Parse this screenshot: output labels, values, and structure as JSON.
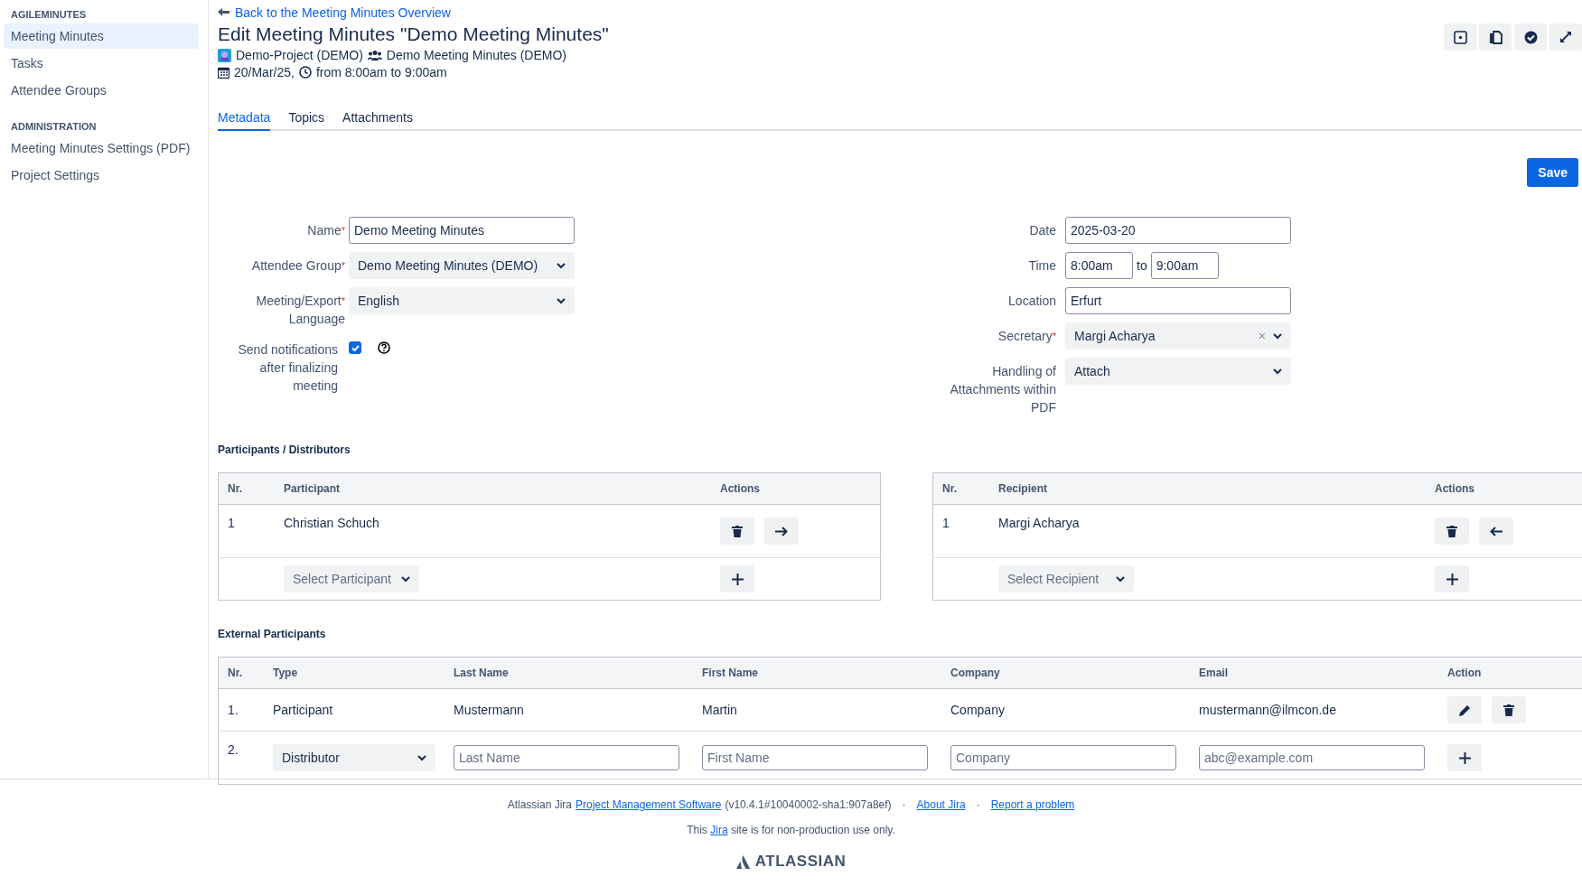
{
  "sidebar": {
    "sections": [
      {
        "heading": "AGILEMINUTES",
        "items": [
          {
            "label": "Meeting Minutes",
            "selected": true
          },
          {
            "label": "Tasks",
            "selected": false
          },
          {
            "label": "Attendee Groups",
            "selected": false
          }
        ]
      },
      {
        "heading": "ADMINISTRATION",
        "items": [
          {
            "label": "Meeting Minutes Settings (PDF)",
            "selected": false
          },
          {
            "label": "Project Settings",
            "selected": false
          }
        ]
      }
    ]
  },
  "header": {
    "back_link": "Back to the Meeting Minutes Overview",
    "title": "Edit Meeting Minutes \"Demo Meeting Minutes\"",
    "project": "Demo-Project (DEMO)",
    "group": "Demo Meeting Minutes (DEMO)",
    "date": "20/Mar/25,",
    "time": "from 8:00am to 9:00am"
  },
  "tabs": [
    {
      "label": "Metadata",
      "selected": true
    },
    {
      "label": "Topics",
      "selected": false
    },
    {
      "label": "Attachments",
      "selected": false
    }
  ],
  "save_button": "Save",
  "form_left": [
    {
      "kind": "text",
      "label": "Name",
      "marker": "*",
      "value": "Demo Meeting Minutes"
    },
    {
      "kind": "select",
      "label": "Attendee Group",
      "marker": "*",
      "value": "Demo Meeting Minutes (DEMO)"
    },
    {
      "kind": "select",
      "label": "Meeting/Export",
      "marker": "*",
      "label_cont": "Language",
      "value": "English"
    },
    {
      "kind": "checkbox",
      "label": "Send notifications after finalizing meeting",
      "checked": true
    }
  ],
  "form_right": [
    {
      "kind": "text",
      "label": "Date",
      "value": "2025-03-20"
    },
    {
      "kind": "time",
      "label": "Time",
      "from": "8:00am",
      "separator": "to",
      "to": "9:00am"
    },
    {
      "kind": "text",
      "label": "Location",
      "value": "Erfurt"
    },
    {
      "kind": "select",
      "label": "Secretary",
      "marker": "*",
      "value": "Margi Acharya",
      "clear": "×"
    },
    {
      "kind": "select",
      "label": "Handling of Attachments within PDF",
      "value": "Attach"
    }
  ],
  "participants_heading": "Participants / Distributors",
  "participants": {
    "columns": [
      "Nr.",
      "Participant",
      "Actions"
    ],
    "rows": [
      {
        "nr": "1",
        "name": "Christian Schuch"
      }
    ],
    "add_placeholder": "Select Participant",
    "kind": "participants"
  },
  "recipients": {
    "columns": [
      "Nr.",
      "Recipient",
      "Actions"
    ],
    "rows": [
      {
        "nr": "1",
        "name": "Margi Acharya"
      }
    ],
    "add_placeholder": "Select Recipient",
    "kind": "recipients"
  },
  "external_heading": "External Participants",
  "external": {
    "columns": [
      "Nr.",
      "Type",
      "Last Name",
      "First Name",
      "Company",
      "Email",
      "Action"
    ],
    "rows": [
      {
        "nr": "1.",
        "type": "Participant",
        "last_name": "Mustermann",
        "first_name": "Martin",
        "company": "Company",
        "email": "mustermann@ilmcon.de"
      }
    ],
    "new_row": {
      "nr": "2.",
      "type": "Distributor",
      "last_name_placeholder": "Last Name",
      "first_name_placeholder": "First Name",
      "company_placeholder": "Company",
      "email_placeholder": "abc@example.com"
    }
  },
  "footer": {
    "product": "Atlassian Jira",
    "product_link": "Project Management Software",
    "version": "(v10.4.1#10040002-sha1:907a8ef)",
    "separator": "·",
    "about_link": "About Jira",
    "report_link": "Report a problem",
    "notice": [
      {
        "text": "This "
      },
      {
        "text": "Jira",
        "link": true
      },
      {
        "text": " site is for non-production use only."
      }
    ],
    "logo": "ATLASSIAN"
  }
}
